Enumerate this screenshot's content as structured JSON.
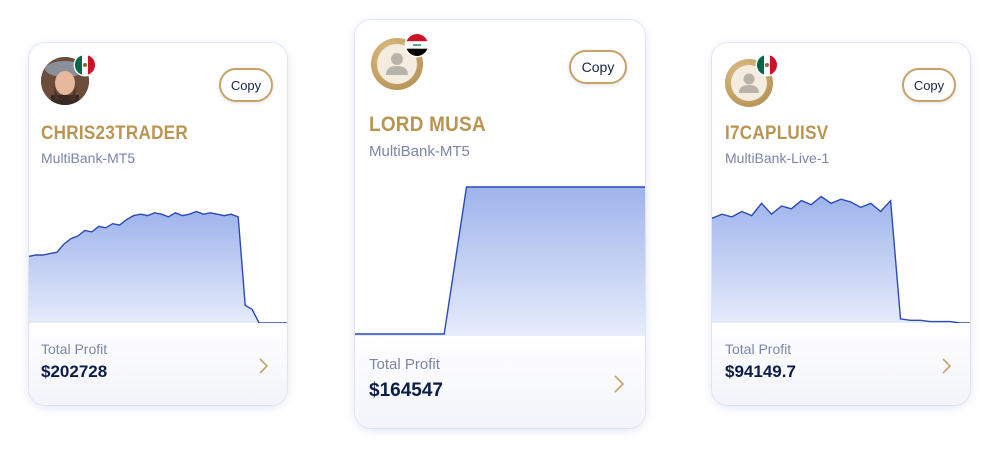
{
  "theme": {
    "gold": "#b99552",
    "navy": "#0b1b4a",
    "chart_line": "#2a4bb5",
    "chart_fill": "#9fb4ec",
    "muted": "#7b85a8"
  },
  "cards": [
    {
      "name": "CHRIS23TRADER",
      "server": "MultiBank-MT5",
      "copy_label": "Copy",
      "profit_label": "Total Profit",
      "profit_value": "$202728",
      "avatar": "user-photo",
      "flag": "mexico-flag-icon",
      "equity_curve": [
        0.49,
        0.5,
        0.5,
        0.51,
        0.52,
        0.58,
        0.62,
        0.64,
        0.68,
        0.67,
        0.71,
        0.7,
        0.73,
        0.72,
        0.76,
        0.79,
        0.8,
        0.79,
        0.81,
        0.8,
        0.78,
        0.81,
        0.79,
        0.8,
        0.82,
        0.8,
        0.81,
        0.8,
        0.79,
        0.8,
        0.78,
        0.13,
        0.1,
        0.0,
        0.0,
        0.0,
        0.0,
        0.0
      ]
    },
    {
      "name": "LORD MUSA",
      "server": "MultiBank-MT5",
      "copy_label": "Copy",
      "profit_label": "Total Profit",
      "profit_value": "$164547",
      "avatar": "user-placeholder-icon",
      "flag": "iraq-flag-icon",
      "equity_curve": [
        0.0,
        0.0,
        0.0,
        0.0,
        0.0,
        0.98,
        0.98,
        0.98,
        0.98,
        0.98,
        0.98,
        0.98,
        0.98,
        0.98
      ]
    },
    {
      "name": "I7CAPLUISV",
      "server": "MultiBank-Live-1",
      "copy_label": "Copy",
      "profit_label": "Total Profit",
      "profit_value": "$94149.7",
      "avatar": "user-placeholder-icon",
      "flag": "mexico-flag-icon",
      "equity_curve": [
        0.77,
        0.8,
        0.78,
        0.82,
        0.79,
        0.88,
        0.8,
        0.86,
        0.84,
        0.9,
        0.87,
        0.93,
        0.88,
        0.91,
        0.89,
        0.85,
        0.88,
        0.82,
        0.9,
        0.03,
        0.02,
        0.02,
        0.01,
        0.01,
        0.01,
        0.0,
        0.0
      ]
    }
  ]
}
